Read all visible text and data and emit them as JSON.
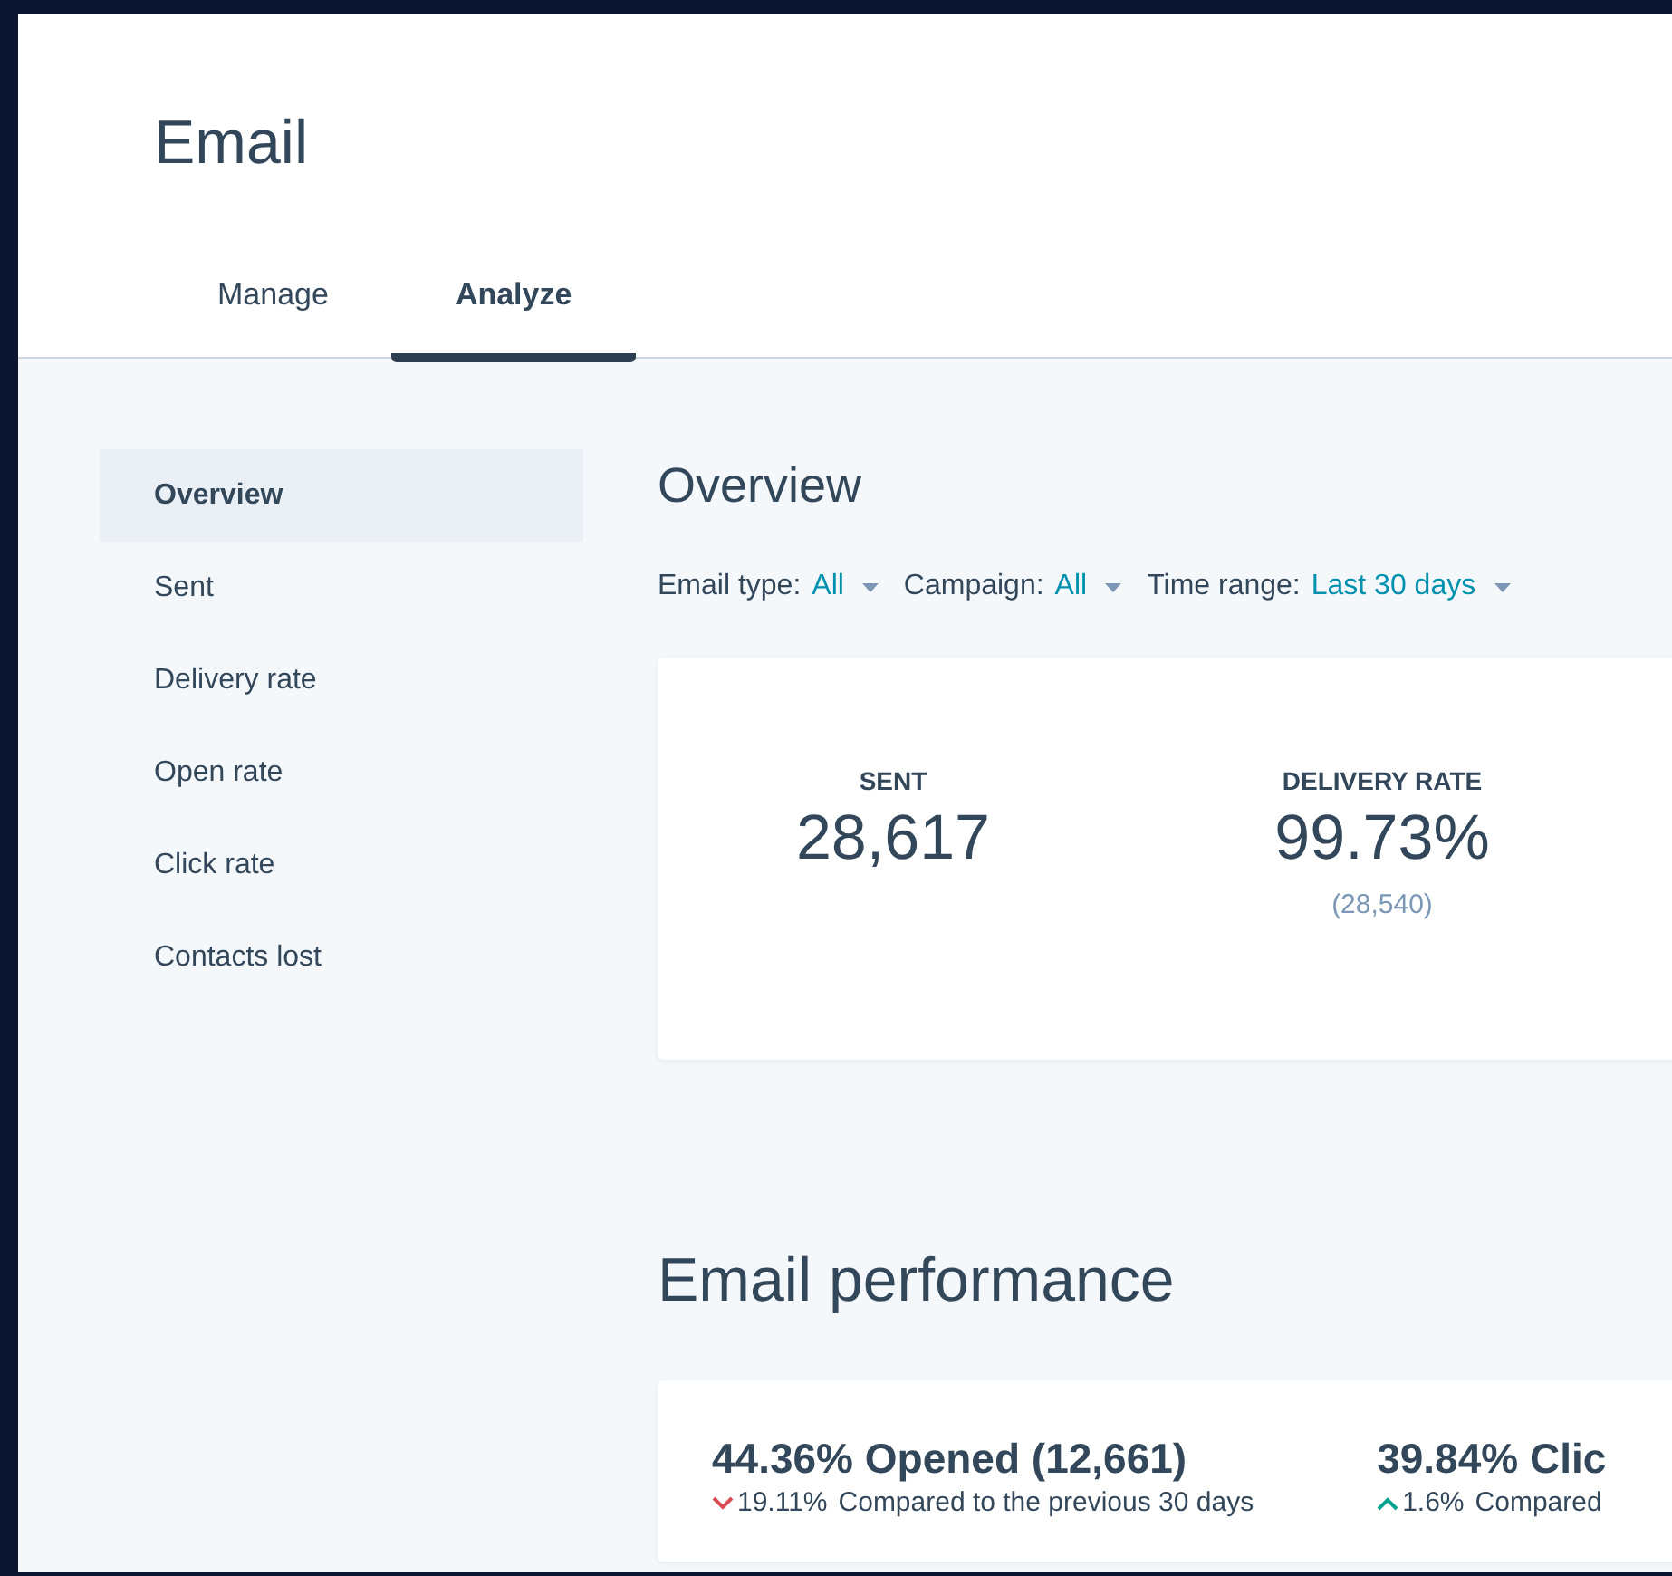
{
  "header": {
    "title": "Email"
  },
  "tabs": [
    {
      "label": "Manage",
      "selected": false
    },
    {
      "label": "Analyze",
      "selected": true
    }
  ],
  "sidebar": {
    "items": [
      {
        "label": "Overview",
        "selected": true
      },
      {
        "label": "Sent",
        "selected": false
      },
      {
        "label": "Delivery rate",
        "selected": false
      },
      {
        "label": "Open rate",
        "selected": false
      },
      {
        "label": "Click rate",
        "selected": false
      },
      {
        "label": "Contacts lost",
        "selected": false
      }
    ]
  },
  "overview": {
    "title": "Overview",
    "filters": [
      {
        "label": "Email type:",
        "value": "All"
      },
      {
        "label": "Campaign:",
        "value": "All"
      },
      {
        "label": "Time range:",
        "value": "Last 30 days"
      }
    ],
    "stats": [
      {
        "label": "SENT",
        "value": "28,617"
      },
      {
        "label": "DELIVERY RATE",
        "value": "99.73%",
        "sub": "(28,540)"
      }
    ]
  },
  "performance": {
    "title": "Email performance",
    "metrics": [
      {
        "headline": "44.36% Opened (12,661)",
        "kind": "down",
        "change": "19.11%",
        "note": "Compared to the previous 30 days"
      },
      {
        "headline": "39.84% Clic",
        "kind": "up",
        "change": "1.6%",
        "note": "Compared"
      }
    ]
  }
}
